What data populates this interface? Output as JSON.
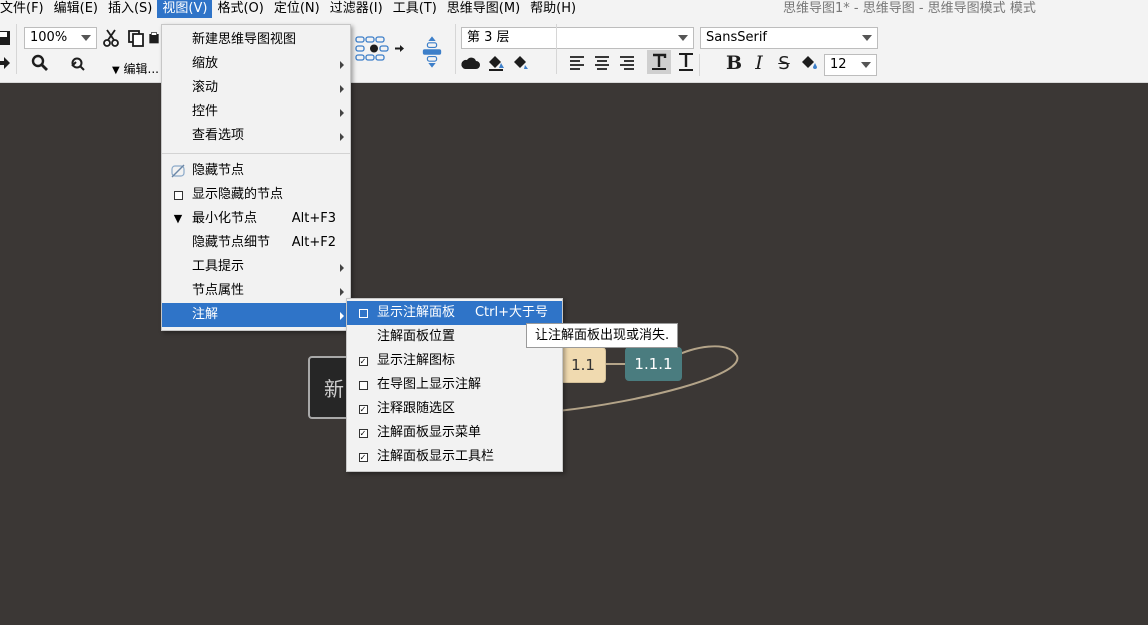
{
  "window_title": "思维导图1* - 思维导图 - 思维导图模式 模式",
  "menubar": {
    "items": [
      "文件(F)",
      "编辑(E)",
      "插入(S)",
      "视图(V)",
      "格式(O)",
      "定位(N)",
      "过滤器(I)",
      "工具(T)",
      "思维导图(M)",
      "帮助(H)"
    ],
    "active": "视图(V)"
  },
  "toolbar": {
    "zoom_value": "100%",
    "edit_label": "编辑...",
    "level_value": "第 3 层",
    "font_value": "SansSerif",
    "size_value": "12",
    "icons": [
      "save-icon",
      "forward-icon",
      "search-icon",
      "find-replace-icon",
      "cut-icon",
      "copy-icon",
      "paste-icon",
      "node-layout-icon",
      "align-icon",
      "cloud-icon",
      "fill-color-icon",
      "edge-color-icon",
      "align-left-icon",
      "align-center-icon",
      "align-right-icon",
      "text-underline-icon",
      "text-strike-icon",
      "bold-icon",
      "italic-icon",
      "strikethrough-icon",
      "paint-bucket-icon"
    ]
  },
  "canvas": {
    "nodes": {
      "root_label": "新",
      "child_label": "1.1",
      "grandchild_label": "1.1.1"
    },
    "colors": {
      "background": "#3b3735",
      "child_fill": "#f0dab0",
      "grandchild_fill": "#4a7c7f",
      "edge": "#b4a489"
    }
  },
  "view_menu": {
    "items": [
      {
        "label": "新建思维导图视图",
        "lead": "",
        "accel": "",
        "sub": false
      },
      {
        "label": "缩放",
        "lead": "",
        "accel": "",
        "sub": true
      },
      {
        "label": "滚动",
        "lead": "",
        "accel": "",
        "sub": true
      },
      {
        "label": "控件",
        "lead": "",
        "accel": "",
        "sub": true
      },
      {
        "label": "查看选项",
        "lead": "",
        "accel": "",
        "sub": true
      },
      {
        "sep": true
      },
      {
        "label": "隐藏节点",
        "lead": "hide-icon",
        "accel": "",
        "sub": false
      },
      {
        "label": "显示隐藏的节点",
        "lead": "checkbox-empty",
        "accel": "",
        "sub": false
      },
      {
        "label": "最小化节点",
        "lead": "triangle-down-icon",
        "accel": "Alt+F3",
        "sub": false
      },
      {
        "label": "隐藏节点细节",
        "lead": "",
        "accel": "Alt+F2",
        "sub": false
      },
      {
        "label": "工具提示",
        "lead": "",
        "accel": "",
        "sub": true
      },
      {
        "label": "节点属性",
        "lead": "",
        "accel": "",
        "sub": true
      },
      {
        "label": "注解",
        "lead": "",
        "accel": "",
        "sub": true,
        "selected": true
      }
    ]
  },
  "notes_submenu": {
    "items": [
      {
        "label": "显示注解面板",
        "check": "empty",
        "accel": "Ctrl+大于号",
        "selected": true
      },
      {
        "label": "注解面板位置",
        "check": "none",
        "accel": ""
      },
      {
        "label": "显示注解图标",
        "check": "checked",
        "accel": ""
      },
      {
        "label": "在导图上显示注解",
        "check": "empty",
        "accel": ""
      },
      {
        "label": "注释跟随选区",
        "check": "checked",
        "accel": ""
      },
      {
        "label": "注解面板显示菜单",
        "check": "checked",
        "accel": ""
      },
      {
        "label": "注解面板显示工具栏",
        "check": "checked",
        "accel": ""
      }
    ]
  },
  "tooltip": {
    "text": "让注解面板出现或消失."
  }
}
